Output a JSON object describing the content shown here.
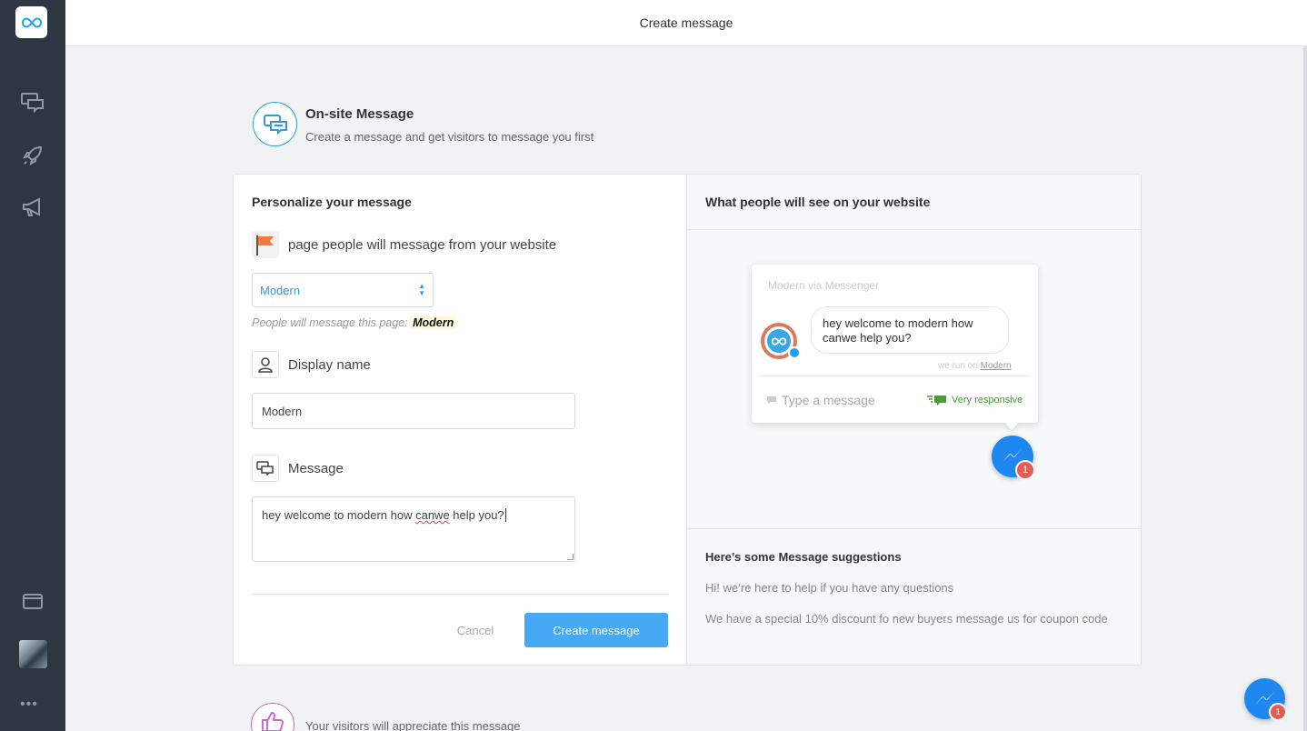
{
  "header": {
    "title": "Create message"
  },
  "sidebar": {
    "items": [
      {
        "icon": "chat-bubbles-icon"
      },
      {
        "icon": "rocket-icon"
      },
      {
        "icon": "megaphone-icon"
      },
      {
        "icon": "wallet-icon"
      }
    ],
    "more": "•••"
  },
  "section": {
    "title": "On-site Message",
    "subtitle": "Create a message and get visitors to message you first"
  },
  "form": {
    "title": "Personalize your message",
    "page_label": "page people will message from your website",
    "page_select": {
      "value": "Modern"
    },
    "hint_prefix": "People will message this page:",
    "hint_value": "Modern",
    "display_name_label": "Display name",
    "display_name_value": "Modern",
    "message_label": "Message",
    "message_value_a": "hey welcome to modern how ",
    "message_value_b": "canwe",
    "message_value_c": " help you?",
    "cancel_label": "Cancel",
    "create_label": "Create message"
  },
  "preview": {
    "title": "What people will see on your website",
    "widget_title": "Modern via Messenger",
    "bubble_text": "hey welcome to modern how canwe help you?",
    "powered_prefix": "we run on",
    "powered_link": "Modern",
    "input_placeholder": "Type a message",
    "responsiveness": "Very responsive",
    "badge_count": "1"
  },
  "suggestions": {
    "title": "Here’s some Message suggestions",
    "items": [
      "Hi! we’re here to help if you have any questions",
      "We have a special 10% discount fo new buyers message us for coupon code"
    ]
  },
  "bottom": {
    "text": "Your visitors will appreciate this message"
  },
  "page_fab": {
    "badge_count": "1"
  },
  "colors": {
    "accent": "#45a9f5",
    "messenger": "#1e88f0",
    "badge": "#e35c55",
    "sidebar": "#2e3642"
  }
}
